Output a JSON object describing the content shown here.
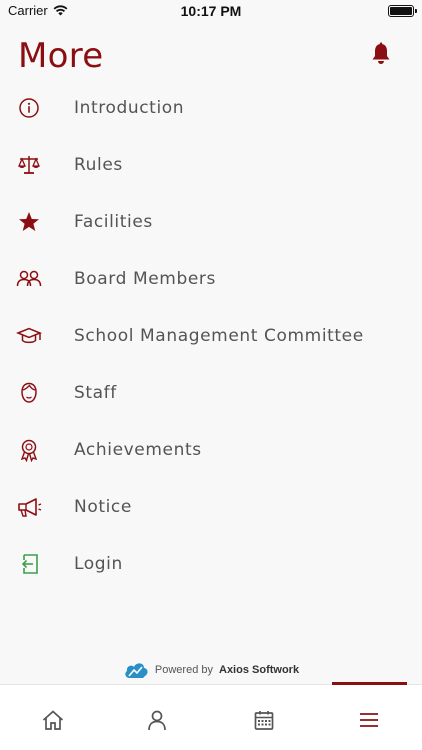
{
  "status_bar": {
    "carrier": "Carrier",
    "time": "10:17 PM"
  },
  "header": {
    "title": "More",
    "notification_icon": "bell-icon"
  },
  "menu": {
    "items": [
      {
        "label": "Introduction",
        "icon": "info-icon"
      },
      {
        "label": "Rules",
        "icon": "scales-icon"
      },
      {
        "label": "Facilities",
        "icon": "star-icon"
      },
      {
        "label": "Board Members",
        "icon": "people-icon"
      },
      {
        "label": "School Management Committee",
        "icon": "graduation-cap-icon"
      },
      {
        "label": "Staff",
        "icon": "face-icon"
      },
      {
        "label": "Achievements",
        "icon": "award-icon"
      },
      {
        "label": "Notice",
        "icon": "megaphone-icon"
      },
      {
        "label": "Login",
        "icon": "login-icon"
      }
    ]
  },
  "footer": {
    "powered_by": "Powered by",
    "brand": "Axios Softwork"
  },
  "tabbar": {
    "tabs": [
      {
        "icon": "home-icon"
      },
      {
        "icon": "profile-icon"
      },
      {
        "icon": "calendar-icon"
      },
      {
        "icon": "menu-icon",
        "active": true
      }
    ]
  },
  "colors": {
    "accent": "#8b0f12",
    "login_green": "#3aa04a",
    "text": "#545454"
  }
}
